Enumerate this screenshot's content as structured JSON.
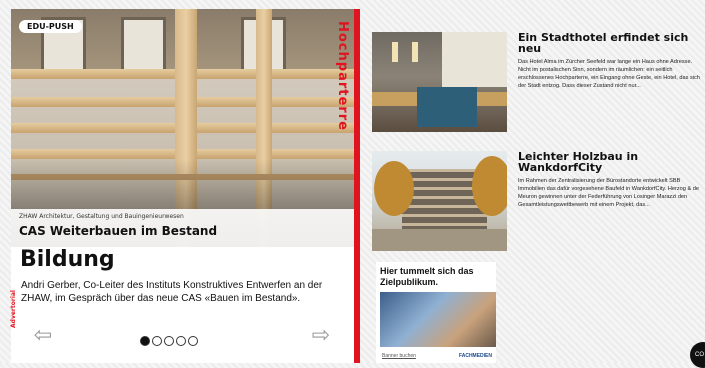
{
  "left_card": {
    "badge": "EDU-PUSH",
    "vertical_label": "Hochparterre",
    "hero_kicker": "ZHAW Architektur, Gestaltung und Bauingenieurwesen",
    "hero_title": "CAS Weiterbauen im Bestand",
    "section_title": "Bildung",
    "advert_tag": "Advertorial",
    "teaser": "Andri Gerber, Co-Leiter des Instituts Konstruktives Entwerfen an der ZHAW, im Gespräch über das neue CAS «Bauen im Bestand».",
    "prev_icon": "arrow-left-icon",
    "next_icon": "arrow-right-icon",
    "slides_total": 5,
    "slide_active": 1
  },
  "articles": [
    {
      "title": "Ein Stadthotel erfindet sich neu",
      "text": "Das Hotel Alma im Zürcher Seefeld war lange ein Haus ohne Adresse. Nicht im postalischen Sinn, sondern im räumlichen: ein seitlich erschlossenes Hochparterre, ein Eingang ohne Geste, ein Hotel, das sich der Stadt entzog. Dass dieser Zustand nicht nur..."
    },
    {
      "title": "Leichter Holzbau in WankdorfCity",
      "text": "Im Rahmen der Zentralisierung der Bürostandorte entwickelt SBB Immobilien das dafür vorgesehene Baufeld in WankdorfCity. Herzog & de Meuron gewinnen unter der Federführung von Losinger Marazzi den Gesamtleistungswettbewerb mit einem Projekt, das..."
    }
  ],
  "ad": {
    "title": "Hier tummelt sich das Zielpublikum.",
    "book_link": "Banner buchen",
    "brand": "FACHMEDIEN"
  },
  "fab_label": "CO",
  "colors": {
    "accent": "#e0141e",
    "text": "#111111"
  }
}
